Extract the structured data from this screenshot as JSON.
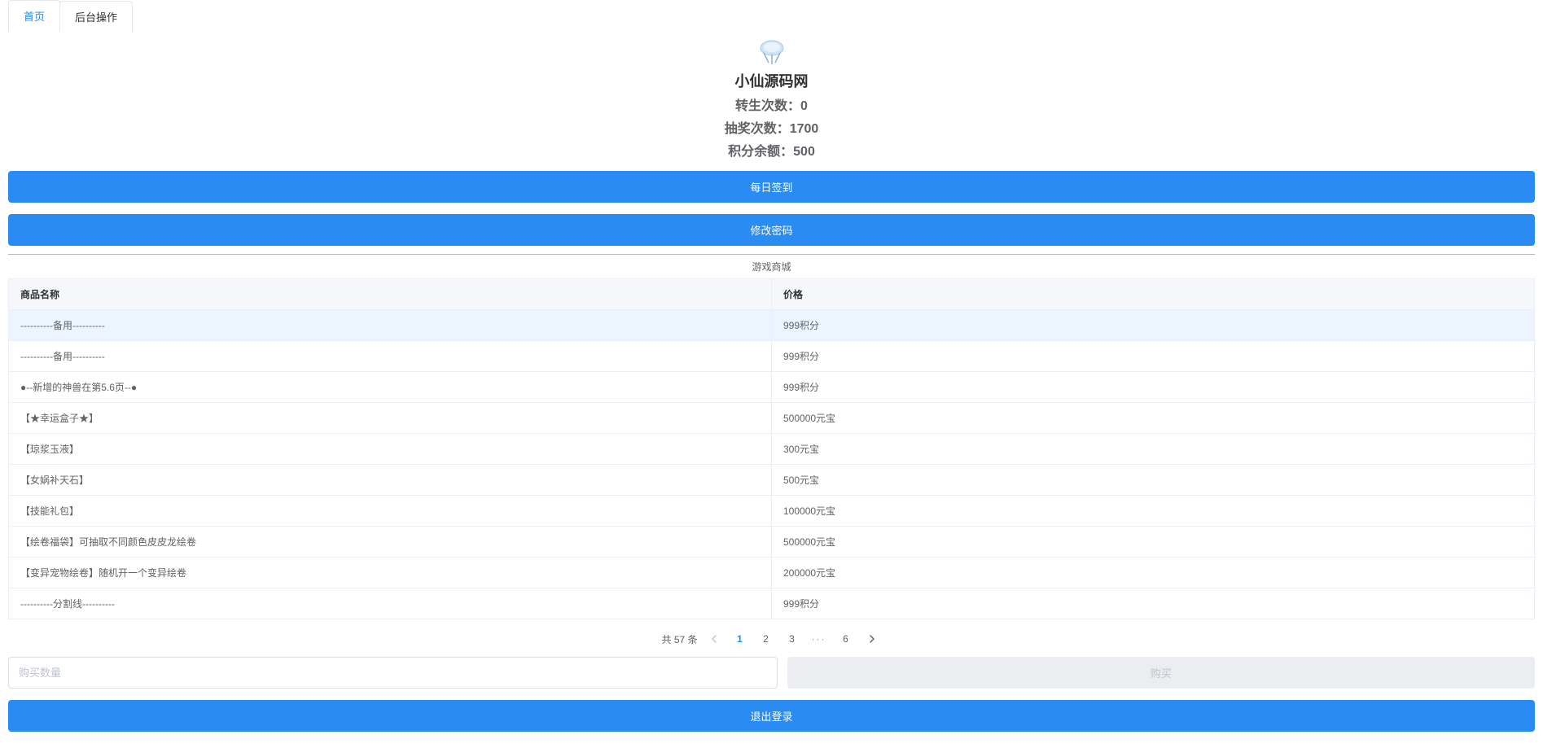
{
  "tabs": {
    "home": "首页",
    "admin": "后台操作"
  },
  "header": {
    "site_name": "小仙源码网",
    "rebirth_label": "转生次数：",
    "rebirth_value": "0",
    "lottery_label": "抽奖次数：",
    "lottery_value": "1700",
    "points_label": "积分余额：",
    "points_value": "500"
  },
  "buttons": {
    "daily_checkin": "每日签到",
    "change_password": "修改密码",
    "buy": "购买",
    "logout": "退出登录"
  },
  "shop": {
    "title": "游戏商城",
    "columns": {
      "name": "商品名称",
      "price": "价格"
    },
    "rows": [
      {
        "name": "----------备用----------",
        "price": "999积分",
        "highlight": true
      },
      {
        "name": "----------备用----------",
        "price": "999积分"
      },
      {
        "name": "●--新增的神兽在第5.6页--●",
        "price": "999积分"
      },
      {
        "name": "【★幸运盒子★】",
        "price": "500000元宝"
      },
      {
        "name": "【琼浆玉液】",
        "price": "300元宝"
      },
      {
        "name": "【女娲补天石】",
        "price": "500元宝"
      },
      {
        "name": "【技能礼包】",
        "price": "100000元宝"
      },
      {
        "name": "【绘卷福袋】可抽取不同颜色皮皮龙绘卷",
        "price": "500000元宝"
      },
      {
        "name": "【变异宠物绘卷】随机开一个变异绘卷",
        "price": "200000元宝"
      },
      {
        "name": "----------分割线----------",
        "price": "999积分"
      }
    ]
  },
  "pagination": {
    "total_text": "共 57 条",
    "pages": [
      "1",
      "2",
      "3",
      "6"
    ],
    "current": "1"
  },
  "purchase": {
    "qty_placeholder": "购买数量"
  }
}
